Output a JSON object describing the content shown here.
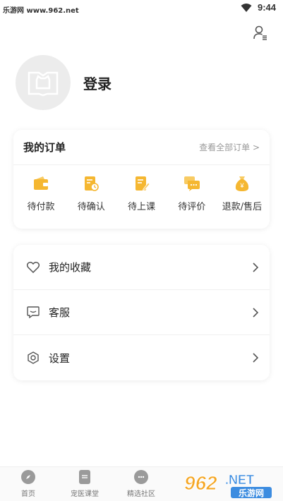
{
  "status_bar": {
    "site": "乐游网 www.962.net",
    "time": "9:44"
  },
  "profile": {
    "login_label": "登录"
  },
  "orders": {
    "title": "我的订单",
    "view_all": "查看全部订单 >",
    "items": [
      {
        "label": "待付款",
        "icon": "wallet-icon"
      },
      {
        "label": "待确认",
        "icon": "pending-doc-icon"
      },
      {
        "label": "待上课",
        "icon": "class-doc-icon"
      },
      {
        "label": "待评价",
        "icon": "review-chat-icon"
      },
      {
        "label": "退款/售后",
        "icon": "money-bag-icon"
      }
    ]
  },
  "menu": {
    "items": [
      {
        "label": "我的收藏",
        "icon": "heart-icon"
      },
      {
        "label": "客服",
        "icon": "chat-icon"
      },
      {
        "label": "设置",
        "icon": "settings-icon"
      }
    ]
  },
  "tabbar": {
    "tabs": [
      {
        "label": "首页",
        "icon": "compass-icon"
      },
      {
        "label": "宠医课堂",
        "icon": "document-icon"
      },
      {
        "label": "精选社区",
        "icon": "community-icon"
      }
    ]
  },
  "watermark": {
    "text_main": "962",
    "text_suffix": ".NET",
    "text_sub": "乐游网"
  },
  "colors": {
    "accent": "#F5B731",
    "text": "#222222",
    "muted": "#999999"
  }
}
